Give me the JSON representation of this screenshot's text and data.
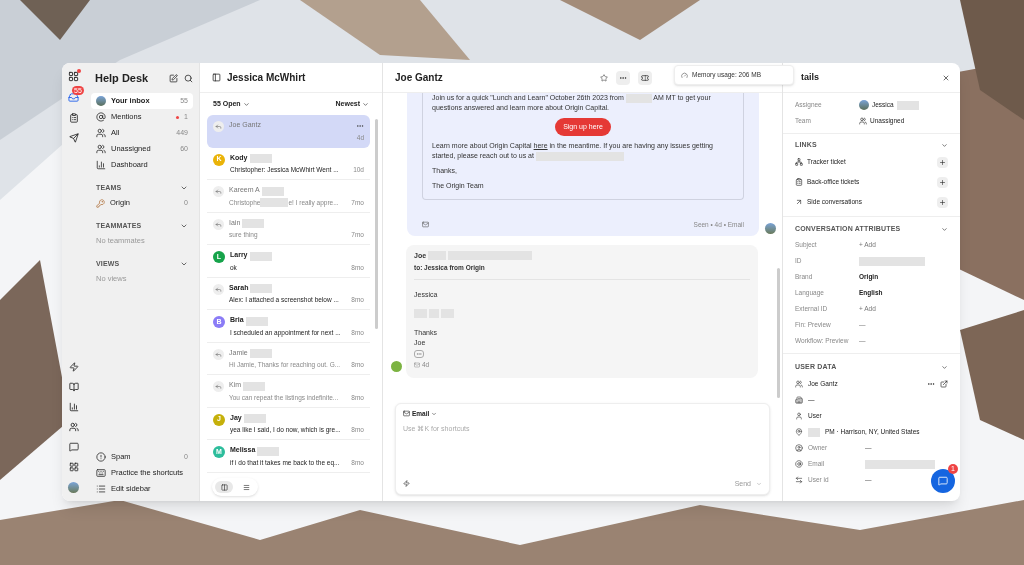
{
  "rail": {
    "inbox_badge": "55",
    "logo_dot": true
  },
  "sidebar": {
    "title": "Help Desk",
    "items": [
      {
        "label": "Your inbox",
        "count": "55",
        "selected": true,
        "dot": false
      },
      {
        "label": "Mentions",
        "count": "1",
        "selected": false,
        "dot": true
      },
      {
        "label": "All",
        "count": "449",
        "selected": false,
        "dot": false
      },
      {
        "label": "Unassigned",
        "count": "60",
        "selected": false,
        "dot": false
      },
      {
        "label": "Dashboard",
        "selected": false,
        "dot": false
      }
    ],
    "sections": [
      {
        "title": "TEAMS",
        "items": [
          {
            "label": "Origin",
            "count": "0"
          }
        ]
      },
      {
        "title": "TEAMMATES",
        "empty": "No teammates"
      },
      {
        "title": "VIEWS",
        "empty": "No views"
      }
    ],
    "bottom": [
      {
        "label": "Spam",
        "count": "0"
      },
      {
        "label": "Practice the shortcuts"
      },
      {
        "label": "Edit sidebar"
      }
    ]
  },
  "list": {
    "title": "Jessica McWhirt",
    "filter": "55 Open",
    "sort": "Newest",
    "items": [
      {
        "kind": "reply",
        "name": "Joe Gantz",
        "time": "4d",
        "selected": true,
        "unread": false,
        "redacted": false
      },
      {
        "kind": "avatar",
        "letter": "K",
        "color": "#eab308",
        "name": "Kody",
        "preview": "Christopher: Jessica McWhirt Went ...",
        "time": "10d",
        "selected": false,
        "unread": true,
        "redacted": true
      },
      {
        "kind": "reply",
        "name": "Kareem A",
        "preview": "Christophe",
        "preview_end": "e! I really appre...",
        "time": "7mo",
        "selected": false,
        "unread": false,
        "redacted": true
      },
      {
        "kind": "reply",
        "name": "Iain",
        "preview": "sure thing",
        "time": "7mo",
        "selected": false,
        "unread": false,
        "redacted": true
      },
      {
        "kind": "avatar",
        "letter": "L",
        "color": "#16a34a",
        "name": "Larry",
        "preview": "ok",
        "time": "8mo",
        "selected": false,
        "unread": true,
        "redacted": true
      },
      {
        "kind": "reply",
        "name": "Sarah",
        "preview": "Alex: I attached a screenshot below ...",
        "time": "8mo",
        "selected": false,
        "unread": true,
        "redacted": true
      },
      {
        "kind": "avatar",
        "letter": "B",
        "color": "#8b7cf6",
        "name": "Bria",
        "preview": "I scheduled an appointment for next ...",
        "time": "8mo",
        "selected": false,
        "unread": true,
        "redacted": true
      },
      {
        "kind": "reply",
        "name": "Jamie",
        "preview": "Hi Jamie, Thanks for reaching out. G...",
        "time": "8mo",
        "selected": false,
        "unread": false,
        "redacted": true
      },
      {
        "kind": "reply",
        "name": "Kim",
        "preview": "You can repeat the listings indefinite...",
        "time": "8mo",
        "selected": false,
        "unread": false,
        "redacted": true
      },
      {
        "kind": "avatar",
        "letter": "J",
        "color": "#c5b00a",
        "name": "Jay",
        "preview": "yea like I said, I do now, which is gre...",
        "time": "8mo",
        "selected": false,
        "unread": true,
        "redacted": true
      },
      {
        "kind": "avatar",
        "letter": "M",
        "color": "#2dbd9c",
        "name": "Melissa",
        "preview": "if i do that it takes me back to the eq...",
        "time": "8mo",
        "selected": false,
        "unread": true,
        "redacted": true
      }
    ],
    "view_toggle": [
      {
        "selected": true
      },
      {
        "selected": false
      }
    ]
  },
  "chat": {
    "title": "Joe Gantz",
    "memory": "Memory usage: 206 MB",
    "email": {
      "p1_start": "Join us for a quick \"Lunch and Learn\" October 26th 2023 from",
      "p1_end": "AM MT to get your questions answered and learn more about Origin Capital.",
      "button": "Sign up here",
      "p2_start": "Learn more about Origin Capital",
      "link": "here",
      "p2_end": "in the meantime. If you are having any issues getting started, please reach out to us at",
      "thanks": "Thanks,",
      "signature": "The Origin Team",
      "meta": "Seen • 4d • Email"
    },
    "reply": {
      "from": "Joe",
      "to": "to: Jessica from Origin",
      "greeting": "Jessica",
      "lines": [
        "Thanks",
        "Joe"
      ],
      "time": "4d"
    },
    "composer": {
      "channel": "Email",
      "placeholder": "Use ⌘K for shortcuts",
      "send": "Send"
    }
  },
  "details": {
    "title": "tails",
    "people": [
      {
        "label": "Assignee",
        "value": "Jessica"
      },
      {
        "label": "Team",
        "value": "Unassigned"
      }
    ],
    "links_title": "LINKS",
    "links": [
      {
        "label": "Tracker ticket"
      },
      {
        "label": "Back-office tickets"
      },
      {
        "label": "Side conversations"
      }
    ],
    "attributes_title": "CONVERSATION ATTRIBUTES",
    "attributes": [
      {
        "label": "Subject",
        "kind": "add",
        "value": "+ Add"
      },
      {
        "label": "ID",
        "kind": "redacted"
      },
      {
        "label": "Brand",
        "kind": "strong",
        "value": "Origin"
      },
      {
        "label": "Language",
        "kind": "strong",
        "value": "English"
      },
      {
        "label": "External ID",
        "kind": "add",
        "value": "+ Add"
      },
      {
        "label": "Fin: Preview",
        "kind": "add",
        "value": "—"
      },
      {
        "label": "Workflow: Preview",
        "kind": "add",
        "value": "—"
      }
    ],
    "user_title": "USER DATA",
    "user": [
      {
        "kind": "strong",
        "value": "Joe Gantz"
      },
      {
        "kind": "strong",
        "value": "—"
      },
      {
        "kind": "strong",
        "value": "User"
      },
      {
        "kind": "location",
        "value": "PM · Harrison, NY, United States"
      },
      {
        "kind": "field",
        "label": "Owner",
        "value": "—"
      },
      {
        "kind": "redacted",
        "label": "Email"
      },
      {
        "kind": "field",
        "label": "User id",
        "value": "—"
      }
    ],
    "messenger_badge": "1"
  }
}
